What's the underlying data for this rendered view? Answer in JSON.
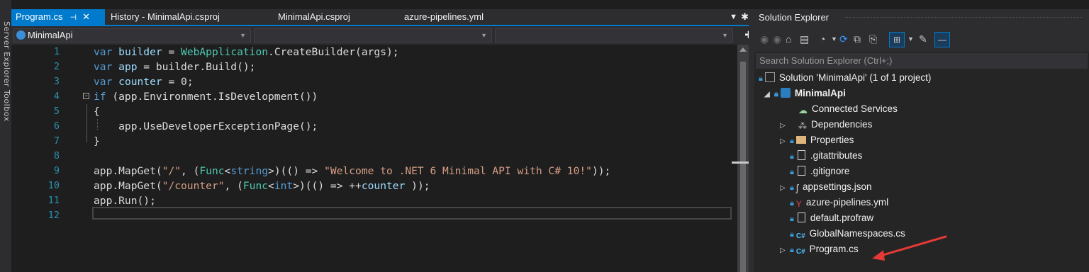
{
  "left_strip": {
    "text": "Server Explorer   Toolbox"
  },
  "tabs": [
    {
      "label": "Program.cs",
      "active": true,
      "pin": "⊣",
      "close": "✕"
    },
    {
      "label": "History - MinimalApi.csproj",
      "active": false
    },
    {
      "label": "MinimalApi.csproj",
      "active": false
    },
    {
      "label": "azure-pipelines.yml",
      "active": false
    }
  ],
  "navbar": {
    "project_combo": "MinimalApi",
    "type_combo": "",
    "member_combo": ""
  },
  "editor": {
    "lines": [
      {
        "num": "1"
      },
      {
        "num": "2"
      },
      {
        "num": "3"
      },
      {
        "num": "4"
      },
      {
        "num": "5"
      },
      {
        "num": "6"
      },
      {
        "num": "7"
      },
      {
        "num": "8"
      },
      {
        "num": "9"
      },
      {
        "num": "10"
      },
      {
        "num": "11"
      },
      {
        "num": "12"
      }
    ],
    "code": {
      "l1_kw": "var",
      "l1_var": "builder",
      "l1_rest1": " = ",
      "l1_type": "WebApplication",
      "l1_rest2": ".CreateBuilder(args);",
      "l2_kw": "var",
      "l2_var": "app",
      "l2_rest": " = builder.Build();",
      "l3_kw": "var",
      "l3_var": "counter",
      "l3_rest": " = 0;",
      "l4_kw": "if",
      "l4_rest": " (app.Environment.IsDevelopment())",
      "l5": "{",
      "l6": "    app.UseDeveloperExceptionPage();",
      "l7": "}",
      "l9_a": "app.MapGet(",
      "l9_str1": "\"/\"",
      "l9_b": ", (",
      "l9_type": "Func",
      "l9_c": "<",
      "l9_kw": "string",
      "l9_d": ">)(() => ",
      "l9_str2": "\"Welcome to .NET 6 Minimal API with C# 10!\"",
      "l9_e": "));",
      "l10_a": "app.MapGet(",
      "l10_str": "\"/counter\"",
      "l10_b": ", (",
      "l10_type": "Func",
      "l10_c": "<",
      "l10_kw": "int",
      "l10_d": ">)(() => ++",
      "l10_var": "counter",
      "l10_e": " ));",
      "l11": "app.Run();"
    }
  },
  "solution_explorer": {
    "title": "Solution Explorer",
    "search_placeholder": "Search Solution Explorer (Ctrl+;)",
    "items": [
      {
        "label": "Solution 'MinimalApi' (1 of 1 project)"
      },
      {
        "label": "MinimalApi"
      },
      {
        "label": "Connected Services"
      },
      {
        "label": "Dependencies"
      },
      {
        "label": "Properties"
      },
      {
        "label": ".gitattributes"
      },
      {
        "label": ".gitignore"
      },
      {
        "label": "appsettings.json"
      },
      {
        "label": "azure-pipelines.yml"
      },
      {
        "label": "default.profraw"
      },
      {
        "label": "GlobalNamespaces.cs"
      },
      {
        "label": "Program.cs"
      }
    ]
  },
  "colors": {
    "accent": "#007acc",
    "annotation_arrow": "#e53935"
  }
}
